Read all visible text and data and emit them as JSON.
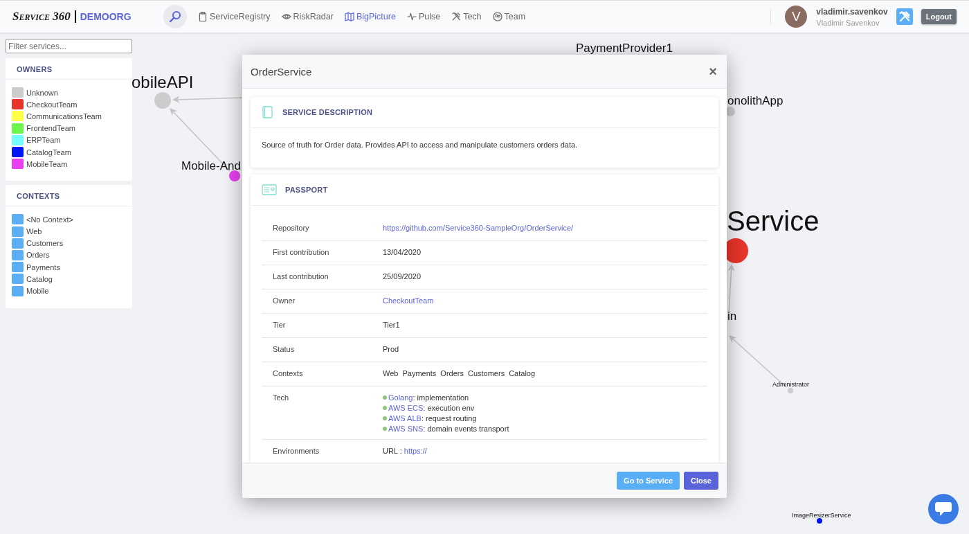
{
  "header": {
    "logo": "Service 360",
    "org": "DEMOORG",
    "nav": [
      {
        "label": "ServiceRegistry",
        "selected": false
      },
      {
        "label": "RiskRadar",
        "selected": false
      },
      {
        "label": "BigPicture",
        "selected": true
      },
      {
        "label": "Pulse",
        "selected": false
      },
      {
        "label": "Tech",
        "selected": false
      },
      {
        "label": "Team",
        "selected": false
      }
    ],
    "user": {
      "avatar_letter": "V",
      "login": "vladimir.savenkov",
      "name": "Vladimir Savenkov"
    },
    "logout": "Logout"
  },
  "filter": {
    "placeholder": "Filter services..."
  },
  "owners": {
    "title": "OWNERS",
    "items": [
      {
        "label": "Unknown",
        "color": "#cccccc"
      },
      {
        "label": "CheckoutTeam",
        "color": "#e8352a"
      },
      {
        "label": "CommunicationsTeam",
        "color": "#ffff44"
      },
      {
        "label": "FrontendTeam",
        "color": "#6cf54a"
      },
      {
        "label": "ERPTeam",
        "color": "#74fbfc"
      },
      {
        "label": "CatalogTeam",
        "color": "#0015f5"
      },
      {
        "label": "MobileTeam",
        "color": "#e93ff0"
      }
    ]
  },
  "contexts": {
    "title": "CONTEXTS",
    "items": [
      {
        "label": "<No Context>",
        "color": "#5aaef6"
      },
      {
        "label": "Web",
        "color": "#5aaef6"
      },
      {
        "label": "Customers",
        "color": "#5aaef6"
      },
      {
        "label": "Orders",
        "color": "#5aaef6"
      },
      {
        "label": "Payments",
        "color": "#5aaef6"
      },
      {
        "label": "Catalog",
        "color": "#5aaef6"
      },
      {
        "label": "Mobile",
        "color": "#5aaef6"
      }
    ]
  },
  "graph": {
    "nodes": [
      {
        "label": "obileAPI",
        "color": "#cccccc"
      },
      {
        "label": "Mobile-And",
        "color": "#e93ff0"
      },
      {
        "label": "PaymentProvider1"
      },
      {
        "label": "onolithApp",
        "color": "#cccccc"
      },
      {
        "label": "Service",
        "color": "#e8352a"
      },
      {
        "label": "in"
      },
      {
        "label": "Administrator",
        "color": "#cccccc"
      },
      {
        "label": "ImageResizerService",
        "color": "#0015f5"
      }
    ]
  },
  "modal": {
    "title": "OrderService",
    "close": "×",
    "description": {
      "title": "SERVICE DESCRIPTION",
      "text": "Source of truth for Order data. Provides API to access and manipulate customers orders data."
    },
    "passport": {
      "title": "PASSPORT",
      "rows": [
        {
          "label": "Repository",
          "kind": "link",
          "value": "https://github.com/Service360-SampleOrg/OrderService/"
        },
        {
          "label": "First contribution",
          "kind": "text",
          "value": "13/04/2020"
        },
        {
          "label": "Last contribution",
          "kind": "text",
          "value": "25/09/2020"
        },
        {
          "label": "Owner",
          "kind": "link",
          "value": "CheckoutTeam"
        },
        {
          "label": "Tier",
          "kind": "text",
          "value": "Tier1"
        },
        {
          "label": "Status",
          "kind": "text",
          "value": "Prod"
        },
        {
          "label": "Contexts",
          "kind": "tags",
          "values": [
            "Web",
            "Payments",
            "Orders",
            "Customers",
            "Catalog"
          ]
        },
        {
          "label": "Tech",
          "kind": "tech",
          "items": [
            {
              "name": "Golang",
              "role": ": implementation"
            },
            {
              "name": "AWS ECS",
              "role": ": execution env"
            },
            {
              "name": "AWS ALB",
              "role": ": request routing"
            },
            {
              "name": "AWS SNS",
              "role": ": domain events transport"
            }
          ]
        },
        {
          "label": "Environments",
          "kind": "env",
          "prefix": "URL :",
          "value": "https://"
        }
      ]
    },
    "buttons": [
      {
        "label": "Go to Service",
        "kind": "secondary"
      },
      {
        "label": "Close",
        "kind": "primary"
      }
    ]
  }
}
